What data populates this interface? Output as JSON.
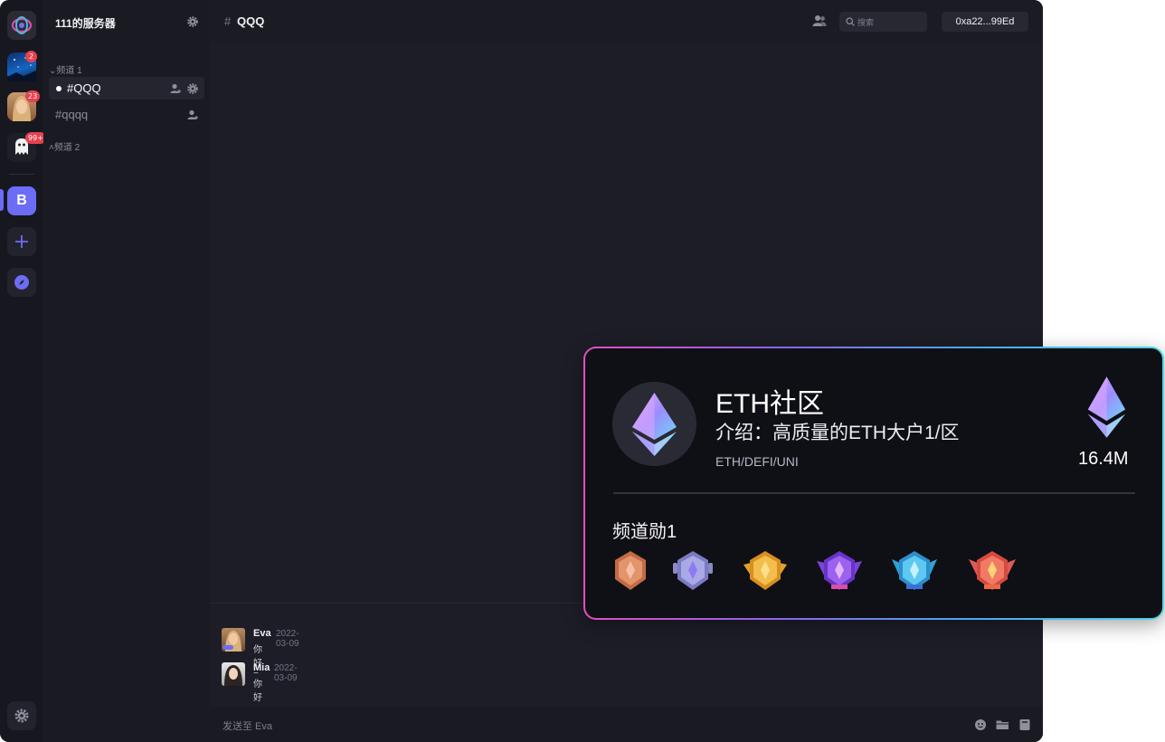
{
  "server_rail": {
    "servers": [
      {
        "name": "home-logo"
      },
      {
        "name": "server-night-sky",
        "badge": "2"
      },
      {
        "name": "server-avatar-woman",
        "badge": "23"
      },
      {
        "name": "server-ghost",
        "badge": "99+"
      }
    ],
    "selected_server_letter": "B",
    "add_icon": "plus-icon",
    "explore_icon": "compass-icon",
    "settings_icon": "gear-icon"
  },
  "sidebar": {
    "server_name": "111的服务器",
    "categories": [
      {
        "label": "频道 1"
      },
      {
        "label": "频道 2"
      }
    ],
    "channels": [
      {
        "label": "#QQQ",
        "active": true
      },
      {
        "label": "#qqqq",
        "active": false
      }
    ]
  },
  "header": {
    "hash": "#",
    "channel_title": "QQQ",
    "search_placeholder": "搜索",
    "wallet": "0xa22...99Ed"
  },
  "messages": [
    {
      "author": "Eva",
      "date": "2022-03-09",
      "text": "你好~"
    },
    {
      "author": "Mia",
      "date": "2022-03-09",
      "text": "你好~"
    }
  ],
  "composer": {
    "placeholder": "发送至 Eva"
  },
  "card": {
    "title": "ETH社区",
    "intro": "介绍：高质量的ETH大户1/区",
    "tags": "ETH/DEFI/UNI",
    "value": "16.4M",
    "medal_section_title": "频道勋1",
    "medals": [
      {
        "name": "bronze-medal",
        "color": "#d4805a"
      },
      {
        "name": "silver-medal",
        "color": "#9a9ad8"
      },
      {
        "name": "gold-medal",
        "color": "#e3a63a"
      },
      {
        "name": "purple-medal",
        "color": "#8a4fe0"
      },
      {
        "name": "cyan-medal",
        "color": "#3fb4e6"
      },
      {
        "name": "red-medal",
        "color": "#e8665a"
      }
    ]
  },
  "colors": {
    "accent": "#6c6cf5",
    "badge": "#e8414d",
    "card_gradient": [
      "#e24fbe",
      "#8a63ee",
      "#4aa8f0",
      "#52d6e6"
    ]
  }
}
